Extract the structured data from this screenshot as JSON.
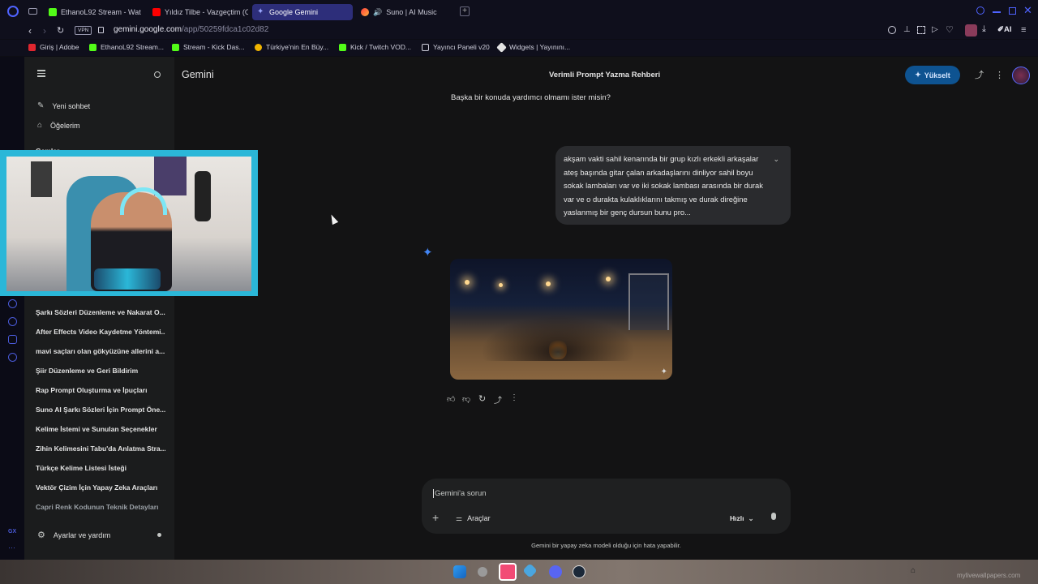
{
  "browser": {
    "tabs": [
      {
        "label": "EthanoL92 Stream - Watc",
        "icon": "kick-icon",
        "color": "#53fc18"
      },
      {
        "label": "Yıldız Tilbe - Vazgeçtim (O",
        "icon": "youtube-icon",
        "color": "#ff0000"
      },
      {
        "label": "Google Gemini",
        "icon": "gemini-icon",
        "color": "#7b8cff"
      },
      {
        "label": "Suno | AI Music",
        "icon": "suno-icon",
        "color": "#ff7a3d"
      }
    ],
    "vpn_label": "VPN",
    "url_host": "gemini.google.com",
    "url_path": "/app/50259fdca1c02d82",
    "ai_label": "AI",
    "bookmarks": [
      {
        "label": "Giriş | Adobe",
        "icon": "adobe-icon",
        "color": "#e0262f"
      },
      {
        "label": "EthanoL92 Stream...",
        "icon": "kick-icon",
        "color": "#53fc18"
      },
      {
        "label": "Stream - Kick Das...",
        "icon": "kick-icon",
        "color": "#53fc18"
      },
      {
        "label": "Türkiye'nin En Büy...",
        "icon": "helmet-icon",
        "color": "#f0b400"
      },
      {
        "label": "Kick / Twitch VOD...",
        "icon": "download-icon",
        "color": "#53fc18"
      },
      {
        "label": "Yayıncı Paneli v20",
        "icon": "page-icon",
        "color": "#cfcfdc"
      },
      {
        "label": "Widgets | Yayınını...",
        "icon": "widget-icon",
        "color": "#e3e3e3"
      }
    ]
  },
  "sidebar": {
    "new_chat": "Yeni sohbet",
    "items": "Öğelerim",
    "section_label": "Gemler",
    "recents": [
      "Şarkı Sözleri Düzenleme ve Nakarat O...",
      "After Effects Video Kaydetme Yöntemi...",
      "mavi saçları olan gökyüzüne allerini a...",
      "Şiir Düzenleme ve Geri Bildirim",
      "Rap Prompt Oluşturma ve İpuçları",
      "Suno AI Şarkı Sözleri İçin Prompt Öne...",
      "Kelime İstemi ve Sunulan Seçenekler",
      "Zihin Kelimesini Tabu'da Anlatma Stra...",
      "Türkçe Kelime Listesi İsteği",
      "Vektör Çizim İçin Yapay Zeka Araçları",
      "Capri Renk Kodunun Teknik Detayları"
    ],
    "settings": "Ayarlar ve yardım"
  },
  "header": {
    "app_name": "Gemini",
    "chat_title": "Verimli Prompt Yazma Rehberi",
    "upgrade_label": "Yükselt"
  },
  "conversation": {
    "prev_model_line": "Başka bir konuda yardımcı olmamı ister misin?",
    "user_message": "akşam vakti sahil kenarında bir grup kızlı erkekli arkaşalar ateş başında gitar çalan arkadaşlarını dinliyor sahil boyu sokak lambaları var ve iki sokak lambası arasında bir durak var ve o durakta kulaklıklarını takmış ve durak direğine yaslanmış bir genç dursun bunu pro..."
  },
  "composer": {
    "placeholder": "Gemini'a sorun",
    "tools_label": "Araçlar",
    "mode_label": "Hızlı"
  },
  "disclaimer": "Gemini bir yapay zeka modeli olduğu için hata yapabilir.",
  "opera_sidebar": {
    "gx_label": "GX"
  },
  "taskbar": {
    "watermark": "mylivewallpapers.com"
  },
  "colors": {
    "accent_blue": "#0b57d0",
    "upgrade_bg": "#0e5391",
    "gemini_star": "#4285f4",
    "webcam_border": "#2bb7d8"
  }
}
